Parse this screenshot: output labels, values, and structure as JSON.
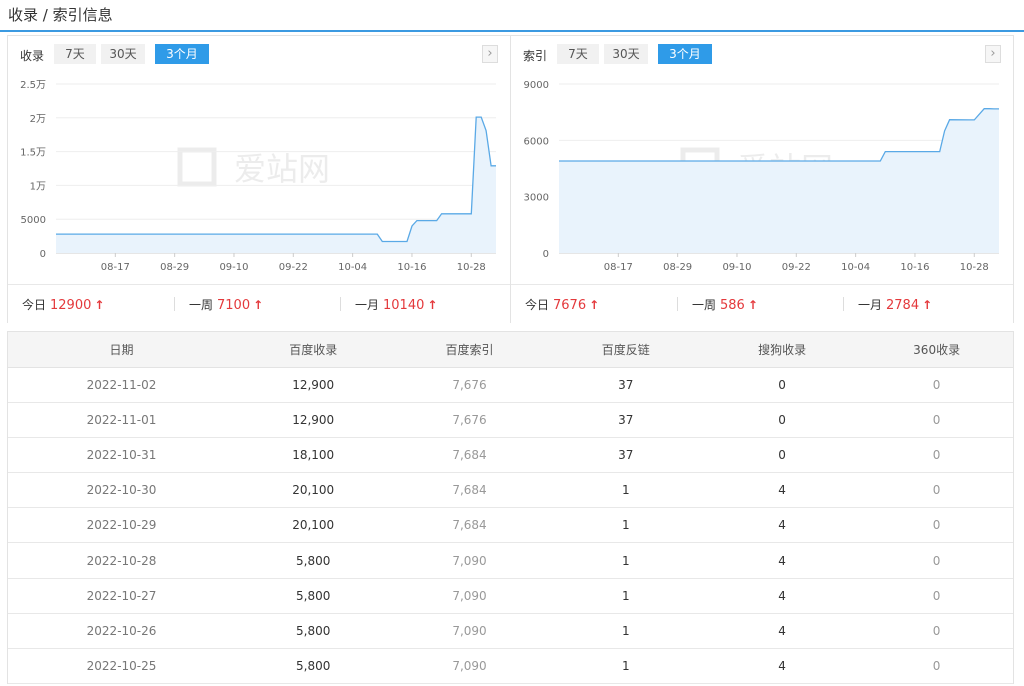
{
  "header": {
    "title": "收录 / 索引信息"
  },
  "panels": [
    {
      "label": "收录",
      "tabs": [
        "7天",
        "30天",
        "3个月"
      ],
      "active_tab": "3个月",
      "watermark": "爱站网",
      "stats": [
        {
          "label": "今日",
          "value": "12900",
          "trend": "up"
        },
        {
          "label": "一周",
          "value": "7100",
          "trend": "up"
        },
        {
          "label": "一月",
          "value": "10140",
          "trend": "up"
        }
      ]
    },
    {
      "label": "索引",
      "tabs": [
        "7天",
        "30天",
        "3个月"
      ],
      "active_tab": "3个月",
      "watermark": "爱站网",
      "stats": [
        {
          "label": "今日",
          "value": "7676",
          "trend": "up"
        },
        {
          "label": "一周",
          "value": "586",
          "trend": "up"
        },
        {
          "label": "一月",
          "value": "2784",
          "trend": "up"
        }
      ]
    }
  ],
  "chart_data": [
    {
      "type": "area",
      "title": "收录",
      "y_ticks": [
        "0",
        "5000",
        "1万",
        "1.5万",
        "2万",
        "2.5万"
      ],
      "ylim": [
        0,
        25000
      ],
      "x_ticks": [
        "08-17",
        "08-29",
        "09-10",
        "09-22",
        "10-04",
        "10-16",
        "10-28"
      ],
      "x": [
        "08-05",
        "08-17",
        "08-29",
        "09-10",
        "09-22",
        "10-04",
        "10-09",
        "10-10",
        "10-15",
        "10-16",
        "10-17",
        "10-21",
        "10-22",
        "10-25",
        "10-26",
        "10-27",
        "10-28",
        "10-29",
        "10-30",
        "10-31",
        "11-01",
        "11-02"
      ],
      "series": [
        {
          "values": [
            2800,
            2800,
            2800,
            2800,
            2800,
            2800,
            2800,
            1700,
            1700,
            4000,
            4800,
            4800,
            5800,
            5800,
            5800,
            5800,
            5800,
            20100,
            20100,
            18100,
            12900,
            12900
          ]
        }
      ],
      "color": "#5aa9e6"
    },
    {
      "type": "area",
      "title": "索引",
      "y_ticks": [
        "0",
        "3000",
        "6000",
        "9000"
      ],
      "ylim": [
        0,
        9000
      ],
      "x_ticks": [
        "08-17",
        "08-29",
        "09-10",
        "09-22",
        "10-04",
        "10-16",
        "10-28"
      ],
      "x": [
        "08-05",
        "08-17",
        "08-29",
        "09-10",
        "09-22",
        "10-04",
        "10-09",
        "10-10",
        "10-21",
        "10-22",
        "10-23",
        "10-27",
        "10-28",
        "10-30",
        "10-31",
        "11-01",
        "11-02"
      ],
      "series": [
        {
          "values": [
            4900,
            4900,
            4900,
            4900,
            4900,
            4900,
            4900,
            5400,
            5400,
            6500,
            7100,
            7090,
            7090,
            7684,
            7684,
            7676,
            7676
          ]
        }
      ],
      "color": "#5aa9e6"
    }
  ],
  "table": {
    "headers": [
      "日期",
      "百度收录",
      "百度索引",
      "百度反链",
      "搜狗收录",
      "360收录"
    ],
    "rows": [
      [
        "2022-11-02",
        "12,900",
        "7,676",
        "37",
        "0",
        "0"
      ],
      [
        "2022-11-01",
        "12,900",
        "7,676",
        "37",
        "0",
        "0"
      ],
      [
        "2022-10-31",
        "18,100",
        "7,684",
        "37",
        "0",
        "0"
      ],
      [
        "2022-10-30",
        "20,100",
        "7,684",
        "1",
        "4",
        "0"
      ],
      [
        "2022-10-29",
        "20,100",
        "7,684",
        "1",
        "4",
        "0"
      ],
      [
        "2022-10-28",
        "5,800",
        "7,090",
        "1",
        "4",
        "0"
      ],
      [
        "2022-10-27",
        "5,800",
        "7,090",
        "1",
        "4",
        "0"
      ],
      [
        "2022-10-26",
        "5,800",
        "7,090",
        "1",
        "4",
        "0"
      ],
      [
        "2022-10-25",
        "5,800",
        "7,090",
        "1",
        "4",
        "0"
      ]
    ]
  }
}
